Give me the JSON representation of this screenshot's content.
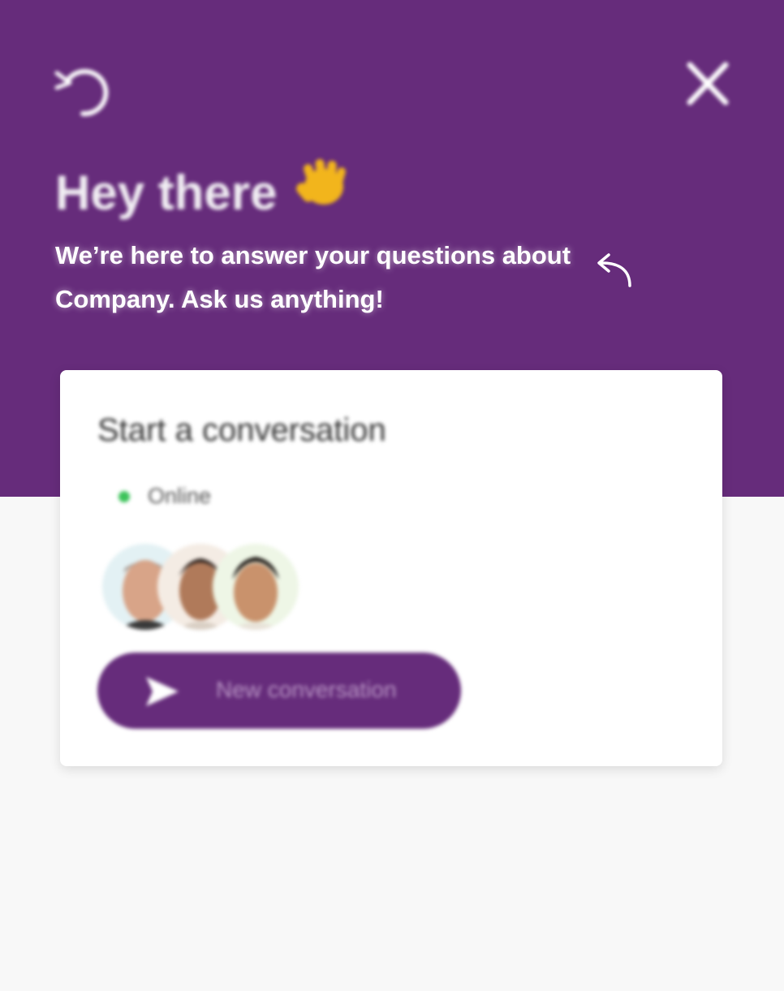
{
  "colors": {
    "brand": "#662c7b",
    "online": "#3cc35a",
    "background": "#f8f8f8",
    "card": "#ffffff"
  },
  "header": {
    "restart_icon": "restart-icon",
    "close_icon": "close-icon",
    "greeting": "Hey there",
    "greeting_emoji": "👋",
    "intro": "We’re here to answer your questions about Company. Ask us anything!",
    "reply_icon": "reply-arrow-icon"
  },
  "card": {
    "title": "Start a conversation",
    "status_label": "Online",
    "avatars": [
      {
        "name": "agent-avatar-1"
      },
      {
        "name": "agent-avatar-2"
      },
      {
        "name": "agent-avatar-3"
      }
    ],
    "button_label": "New conversation",
    "button_icon": "send-icon"
  }
}
